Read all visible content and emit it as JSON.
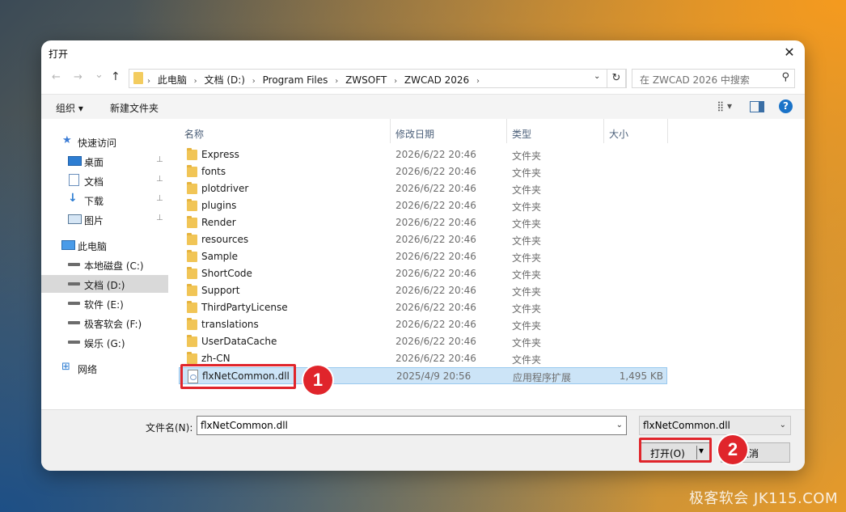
{
  "dialog": {
    "title": "打开",
    "close_glyph": "✕"
  },
  "nav": {
    "back": "←",
    "forward": "→",
    "recent": "⌄",
    "up": "↑"
  },
  "address": {
    "crumbs": [
      "此电脑",
      "文档 (D:)",
      "Program Files",
      "ZWSOFT",
      "ZWCAD 2026"
    ],
    "separator": "›",
    "dropdown": "⌄",
    "refresh": "↻"
  },
  "search": {
    "placeholder": "在 ZWCAD 2026 中搜索",
    "icon": "⚲"
  },
  "toolbar": {
    "organize": "组织 ▾",
    "new_folder": "新建文件夹",
    "view": "⣿ ▾",
    "help": "?"
  },
  "sidebar": {
    "items": [
      {
        "label": "快速访问",
        "icon": "star"
      },
      {
        "label": "桌面",
        "icon": "desktop",
        "pinned": true
      },
      {
        "label": "文档",
        "icon": "document",
        "pinned": true
      },
      {
        "label": "下载",
        "icon": "download",
        "pinned": true
      },
      {
        "label": "图片",
        "icon": "pictures",
        "pinned": true
      },
      {
        "label": "此电脑",
        "icon": "computer"
      },
      {
        "label": "本地磁盘 (C:)",
        "icon": "drive"
      },
      {
        "label": "文档 (D:)",
        "icon": "drive",
        "selected": true
      },
      {
        "label": "软件 (E:)",
        "icon": "drive"
      },
      {
        "label": "极客软会 (F:)",
        "icon": "drive"
      },
      {
        "label": "娱乐 (G:)",
        "icon": "drive"
      },
      {
        "label": "网络",
        "icon": "network"
      }
    ],
    "pin_glyph": "📌"
  },
  "columns": {
    "name": "名称",
    "modified": "修改日期",
    "type": "类型",
    "size": "大小",
    "sort_arrow": "︿"
  },
  "files": [
    {
      "name": "Express",
      "date": "2026/6/22 20:46",
      "type": "文件夹",
      "size": "",
      "kind": "folder"
    },
    {
      "name": "fonts",
      "date": "2026/6/22 20:46",
      "type": "文件夹",
      "size": "",
      "kind": "folder"
    },
    {
      "name": "plotdriver",
      "date": "2026/6/22 20:46",
      "type": "文件夹",
      "size": "",
      "kind": "folder"
    },
    {
      "name": "plugins",
      "date": "2026/6/22 20:46",
      "type": "文件夹",
      "size": "",
      "kind": "folder"
    },
    {
      "name": "Render",
      "date": "2026/6/22 20:46",
      "type": "文件夹",
      "size": "",
      "kind": "folder"
    },
    {
      "name": "resources",
      "date": "2026/6/22 20:46",
      "type": "文件夹",
      "size": "",
      "kind": "folder"
    },
    {
      "name": "Sample",
      "date": "2026/6/22 20:46",
      "type": "文件夹",
      "size": "",
      "kind": "folder"
    },
    {
      "name": "ShortCode",
      "date": "2026/6/22 20:46",
      "type": "文件夹",
      "size": "",
      "kind": "folder"
    },
    {
      "name": "Support",
      "date": "2026/6/22 20:46",
      "type": "文件夹",
      "size": "",
      "kind": "folder"
    },
    {
      "name": "ThirdPartyLicense",
      "date": "2026/6/22 20:46",
      "type": "文件夹",
      "size": "",
      "kind": "folder"
    },
    {
      "name": "translations",
      "date": "2026/6/22 20:46",
      "type": "文件夹",
      "size": "",
      "kind": "folder"
    },
    {
      "name": "UserDataCache",
      "date": "2026/6/22 20:46",
      "type": "文件夹",
      "size": "",
      "kind": "folder"
    },
    {
      "name": "zh-CN",
      "date": "2026/6/22 20:46",
      "type": "文件夹",
      "size": "",
      "kind": "folder"
    },
    {
      "name": "flxNetCommon.dll",
      "date": "2025/4/9 20:56",
      "type": "应用程序扩展",
      "size": "1,495 KB",
      "kind": "dll",
      "selected": true
    }
  ],
  "bottom": {
    "filename_label": "文件名(N):",
    "filename_value": "flxNetCommon.dll",
    "filetype_value": "flxNetCommon.dll",
    "dropdown": "⌄",
    "open_label": "打开(O)",
    "open_arrow": "▾",
    "cancel_label": "取消"
  },
  "callouts": [
    "1",
    "2"
  ],
  "watermark": "极客软会 JK115.COM",
  "colors": {
    "accent_red": "#e0252b",
    "selection": "#cce4f7",
    "folder": "#f1c556"
  }
}
